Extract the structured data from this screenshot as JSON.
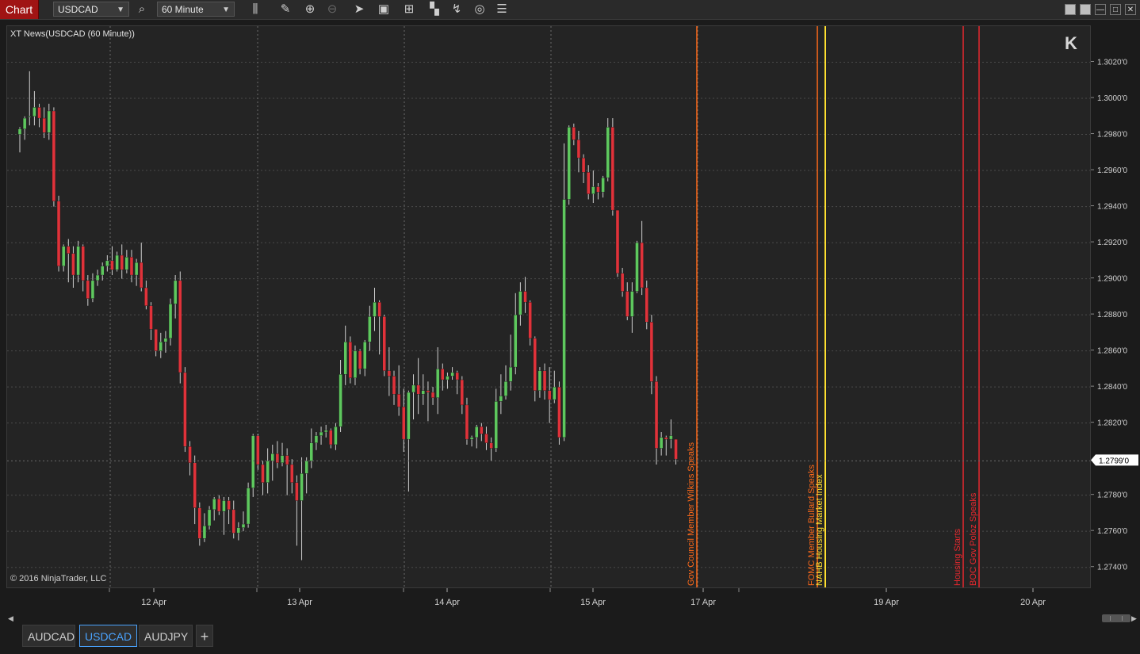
{
  "toolbar": {
    "chart_label": "Chart",
    "instrument": "USDCAD",
    "interval": "60 Minute",
    "icons": [
      "search-icon",
      "bar-type-icon",
      "draw-pencil-icon",
      "zoom-in-icon",
      "zoom-out-icon",
      "pointer-icon",
      "data-box-icon",
      "indicators-icon",
      "strategies-icon",
      "drawing-tools-icon",
      "refresh-icon",
      "properties-icon"
    ],
    "window_buttons": [
      "restore-icon",
      "minimize-icon",
      "maximize-icon",
      "close-icon"
    ]
  },
  "chart": {
    "title": "XT News(USDCAD (60 Minute))",
    "copyright": "© 2016 NinjaTrader, LLC",
    "nav_end_symbol": "K",
    "current_price": "1.2799'0",
    "colors": {
      "background": "#242424",
      "up": "#5ec85e",
      "down": "#e0323a",
      "orange_news": "#ff6a1a",
      "yellow_news": "#ffe030",
      "red_news": "#e8282e",
      "price_tag": "#ffffff"
    }
  },
  "chart_data": {
    "type": "candlestick",
    "instrument": "USDCAD",
    "interval": "60 Minute",
    "y_ticks": [
      "1.3020'0",
      "1.3000'0",
      "1.2980'0",
      "1.2960'0",
      "1.2940'0",
      "1.2920'0",
      "1.2900'0",
      "1.2880'0",
      "1.2860'0",
      "1.2840'0",
      "1.2820'0",
      "1.2780'0",
      "1.2760'0",
      "1.2740'0"
    ],
    "y_tick_values": [
      1.302,
      1.3,
      1.298,
      1.296,
      1.294,
      1.292,
      1.29,
      1.288,
      1.286,
      1.284,
      1.282,
      1.278,
      1.276,
      1.274
    ],
    "ylim": [
      1.2728,
      1.304
    ],
    "x_ticks": [
      "12 Apr",
      "13 Apr",
      "14 Apr",
      "15 Apr",
      "17 Apr",
      "19 Apr",
      "20 Apr"
    ],
    "bars": [
      [
        1.298,
        1.2983,
        1.297,
        1.2984
      ],
      [
        1.2983,
        1.2989,
        1.2977,
        1.299
      ],
      [
        1.299,
        1.299,
        1.2985,
        1.3015
      ],
      [
        1.299,
        1.2995,
        1.2985,
        1.3004
      ],
      [
        1.2995,
        1.2989,
        1.2984,
        1.2997
      ],
      [
        1.2989,
        1.2981,
        1.2978,
        1.2995
      ],
      [
        1.2981,
        1.2993,
        1.2977,
        1.2997
      ],
      [
        1.2993,
        1.2943,
        1.294,
        1.2995
      ],
      [
        1.2943,
        1.2907,
        1.2904,
        1.2946
      ],
      [
        1.2907,
        1.2918,
        1.2904,
        1.2919
      ],
      [
        1.2918,
        1.2914,
        1.2898,
        1.2922
      ],
      [
        1.2914,
        1.2902,
        1.2895,
        1.2918
      ],
      [
        1.2902,
        1.2918,
        1.2898,
        1.2921
      ],
      [
        1.2918,
        1.2899,
        1.2893,
        1.2919
      ],
      [
        1.2899,
        1.2889,
        1.2885,
        1.2902
      ],
      [
        1.2889,
        1.2899,
        1.2887,
        1.2903
      ],
      [
        1.2899,
        1.2902,
        1.2896,
        1.2905
      ],
      [
        1.2902,
        1.2907,
        1.2899,
        1.2909
      ],
      [
        1.2907,
        1.291,
        1.2904,
        1.2913
      ],
      [
        1.291,
        1.2905,
        1.2902,
        1.2918
      ],
      [
        1.2905,
        1.2913,
        1.2904,
        1.2915
      ],
      [
        1.2913,
        1.2905,
        1.29,
        1.2919
      ],
      [
        1.2905,
        1.2912,
        1.2903,
        1.2916
      ],
      [
        1.2912,
        1.2902,
        1.2898,
        1.2916
      ],
      [
        1.2902,
        1.2909,
        1.2896,
        1.2911
      ],
      [
        1.2909,
        1.2895,
        1.2893,
        1.292
      ],
      [
        1.2895,
        1.2885,
        1.2883,
        1.2899
      ],
      [
        1.2885,
        1.2872,
        1.2866,
        1.2887
      ],
      [
        1.2872,
        1.286,
        1.2857,
        1.2872
      ],
      [
        1.286,
        1.2865,
        1.2856,
        1.287
      ],
      [
        1.2865,
        1.2867,
        1.2859,
        1.2871
      ],
      [
        1.2867,
        1.2886,
        1.2863,
        1.2889
      ],
      [
        1.2886,
        1.2899,
        1.2878,
        1.2902
      ],
      [
        1.2899,
        1.2848,
        1.2842,
        1.2904
      ],
      [
        1.2848,
        1.2807,
        1.2804,
        1.2851
      ],
      [
        1.2807,
        1.2798,
        1.2791,
        1.281
      ],
      [
        1.2798,
        1.2773,
        1.2764,
        1.2802
      ],
      [
        1.2773,
        1.2756,
        1.2752,
        1.2776
      ],
      [
        1.2756,
        1.2763,
        1.2754,
        1.277
      ],
      [
        1.2763,
        1.2772,
        1.2761,
        1.2774
      ],
      [
        1.2772,
        1.2778,
        1.2766,
        1.2779
      ],
      [
        1.2778,
        1.2771,
        1.2769,
        1.278
      ],
      [
        1.2771,
        1.2777,
        1.2758,
        1.2779
      ],
      [
        1.2777,
        1.2772,
        1.2764,
        1.2779
      ],
      [
        1.2772,
        1.2759,
        1.2756,
        1.2777
      ],
      [
        1.2759,
        1.2762,
        1.2755,
        1.2765
      ],
      [
        1.2762,
        1.2764,
        1.276,
        1.2771
      ],
      [
        1.2764,
        1.2784,
        1.2762,
        1.2787
      ],
      [
        1.2784,
        1.2813,
        1.2779,
        1.2814
      ],
      [
        1.2813,
        1.2797,
        1.2794,
        1.2814
      ],
      [
        1.2797,
        1.2787,
        1.278,
        1.2799
      ],
      [
        1.2787,
        1.2799,
        1.2781,
        1.2806
      ],
      [
        1.2799,
        1.2803,
        1.2788,
        1.2808
      ],
      [
        1.2803,
        1.2798,
        1.2795,
        1.281
      ],
      [
        1.2798,
        1.2802,
        1.2796,
        1.2809
      ],
      [
        1.2802,
        1.2797,
        1.278,
        1.2806
      ],
      [
        1.2797,
        1.2787,
        1.2781,
        1.28
      ],
      [
        1.2787,
        1.2777,
        1.2752,
        1.2791
      ],
      [
        1.2777,
        1.2792,
        1.2744,
        1.2801
      ],
      [
        1.2792,
        1.2799,
        1.2781,
        1.2801
      ],
      [
        1.2799,
        1.2809,
        1.2795,
        1.2817
      ],
      [
        1.2809,
        1.2813,
        1.2805,
        1.2815
      ],
      [
        1.2813,
        1.2815,
        1.2808,
        1.2818
      ],
      [
        1.2815,
        1.2816,
        1.2812,
        1.2819
      ],
      [
        1.2816,
        1.2808,
        1.2806,
        1.2817
      ],
      [
        1.2808,
        1.2818,
        1.2805,
        1.282
      ],
      [
        1.2818,
        1.2847,
        1.2815,
        1.2855
      ],
      [
        1.2847,
        1.2865,
        1.2841,
        1.2874
      ],
      [
        1.2865,
        1.2845,
        1.2842,
        1.2868
      ],
      [
        1.2845,
        1.286,
        1.2841,
        1.2863
      ],
      [
        1.286,
        1.285,
        1.2847,
        1.2861
      ],
      [
        1.285,
        1.2865,
        1.2846,
        1.2866
      ],
      [
        1.2865,
        1.2879,
        1.286,
        1.2885
      ],
      [
        1.2879,
        1.2887,
        1.2871,
        1.2895
      ],
      [
        1.2887,
        1.2879,
        1.2858,
        1.2888
      ],
      [
        1.2879,
        1.2849,
        1.2846,
        1.288
      ],
      [
        1.2849,
        1.2846,
        1.2835,
        1.2862
      ],
      [
        1.2846,
        1.2836,
        1.283,
        1.2849
      ],
      [
        1.2836,
        1.2829,
        1.2824,
        1.2852
      ],
      [
        1.2829,
        1.2811,
        1.2804,
        1.2839
      ],
      [
        1.2811,
        1.2837,
        1.2782,
        1.2838
      ],
      [
        1.2837,
        1.2841,
        1.2822,
        1.2847
      ],
      [
        1.2841,
        1.2836,
        1.2825,
        1.2856
      ],
      [
        1.2836,
        1.2838,
        1.283,
        1.2847
      ],
      [
        1.2838,
        1.2837,
        1.2821,
        1.2843
      ],
      [
        1.2837,
        1.2834,
        1.283,
        1.284
      ],
      [
        1.2834,
        1.285,
        1.2825,
        1.2862
      ],
      [
        1.285,
        1.2844,
        1.2838,
        1.2853
      ],
      [
        1.2844,
        1.2846,
        1.2839,
        1.2848
      ],
      [
        1.2846,
        1.2848,
        1.2844,
        1.2851
      ],
      [
        1.2848,
        1.2844,
        1.2836,
        1.2849
      ],
      [
        1.2844,
        1.283,
        1.2825,
        1.2846
      ],
      [
        1.283,
        1.2811,
        1.2808,
        1.2834
      ],
      [
        1.2811,
        1.2812,
        1.2807,
        1.2813
      ],
      [
        1.2812,
        1.2818,
        1.2806,
        1.2819
      ],
      [
        1.2818,
        1.2814,
        1.281,
        1.282
      ],
      [
        1.2814,
        1.2809,
        1.2805,
        1.2818
      ],
      [
        1.2809,
        1.2806,
        1.2799,
        1.2812
      ],
      [
        1.2806,
        1.2832,
        1.2804,
        1.2839
      ],
      [
        1.2832,
        1.2835,
        1.2825,
        1.2847
      ],
      [
        1.2835,
        1.2843,
        1.2833,
        1.2852
      ],
      [
        1.2843,
        1.2851,
        1.2838,
        1.2869
      ],
      [
        1.2851,
        1.288,
        1.2847,
        1.2892
      ],
      [
        1.288,
        1.2893,
        1.2874,
        1.2898
      ],
      [
        1.2893,
        1.2887,
        1.2881,
        1.2901
      ],
      [
        1.2887,
        1.2867,
        1.2863,
        1.2888
      ],
      [
        1.2867,
        1.2838,
        1.2832,
        1.2868
      ],
      [
        1.2838,
        1.2849,
        1.2834,
        1.2851
      ],
      [
        1.2849,
        1.2838,
        1.2833,
        1.2853
      ],
      [
        1.2838,
        1.2833,
        1.282,
        1.2851
      ],
      [
        1.2833,
        1.284,
        1.2831,
        1.2849
      ],
      [
        1.284,
        1.2812,
        1.2808,
        1.2843
      ],
      [
        1.2812,
        1.2944,
        1.281,
        1.2975
      ],
      [
        1.2944,
        1.2984,
        1.2941,
        1.2985
      ],
      [
        1.2984,
        1.2977,
        1.2974,
        1.2986
      ],
      [
        1.2977,
        1.2967,
        1.2959,
        1.2982
      ],
      [
        1.2967,
        1.2959,
        1.2953,
        1.2969
      ],
      [
        1.2959,
        1.2947,
        1.2944,
        1.2963
      ],
      [
        1.2947,
        1.2951,
        1.2942,
        1.296
      ],
      [
        1.2951,
        1.2948,
        1.2944,
        1.2953
      ],
      [
        1.2948,
        1.2956,
        1.2945,
        1.2957
      ],
      [
        1.2956,
        1.2984,
        1.2954,
        1.2989
      ],
      [
        1.2984,
        1.2938,
        1.2935,
        1.2989
      ],
      [
        1.2938,
        1.2903,
        1.2901,
        1.2938
      ],
      [
        1.2903,
        1.2893,
        1.289,
        1.2906
      ],
      [
        1.2893,
        1.2879,
        1.2877,
        1.2898
      ],
      [
        1.2879,
        1.2893,
        1.287,
        1.2898
      ],
      [
        1.2893,
        1.292,
        1.2892,
        1.2921
      ],
      [
        1.292,
        1.2895,
        1.2891,
        1.2932
      ],
      [
        1.2895,
        1.2876,
        1.2872,
        1.2899
      ],
      [
        1.2876,
        1.2843,
        1.2836,
        1.288
      ],
      [
        1.2843,
        1.2806,
        1.2797,
        1.2846
      ],
      [
        1.2806,
        1.2812,
        1.2802,
        1.2815
      ],
      [
        1.2812,
        1.2811,
        1.2802,
        1.2813
      ],
      [
        1.2811,
        1.2813,
        1.2806,
        1.2822
      ],
      [
        1.2811,
        1.28,
        1.2797,
        1.2811
      ]
    ],
    "news_events": [
      {
        "label": "Gov Council Member Wilkins Speaks",
        "color": "orange"
      },
      {
        "label": "FOMC Member Bullard Speaks",
        "color": "orange"
      },
      {
        "label": "NAHB Housing Market Index",
        "color": "yellow"
      },
      {
        "label": "Housing Starts",
        "color": "red"
      },
      {
        "label": "BOC Gov Poloz Speaks",
        "color": "red"
      }
    ]
  },
  "tabs": [
    {
      "label": "AUDCAD",
      "active": false
    },
    {
      "label": "USDCAD",
      "active": true
    },
    {
      "label": "AUDJPY",
      "active": false
    }
  ],
  "tab_add_label": "+"
}
